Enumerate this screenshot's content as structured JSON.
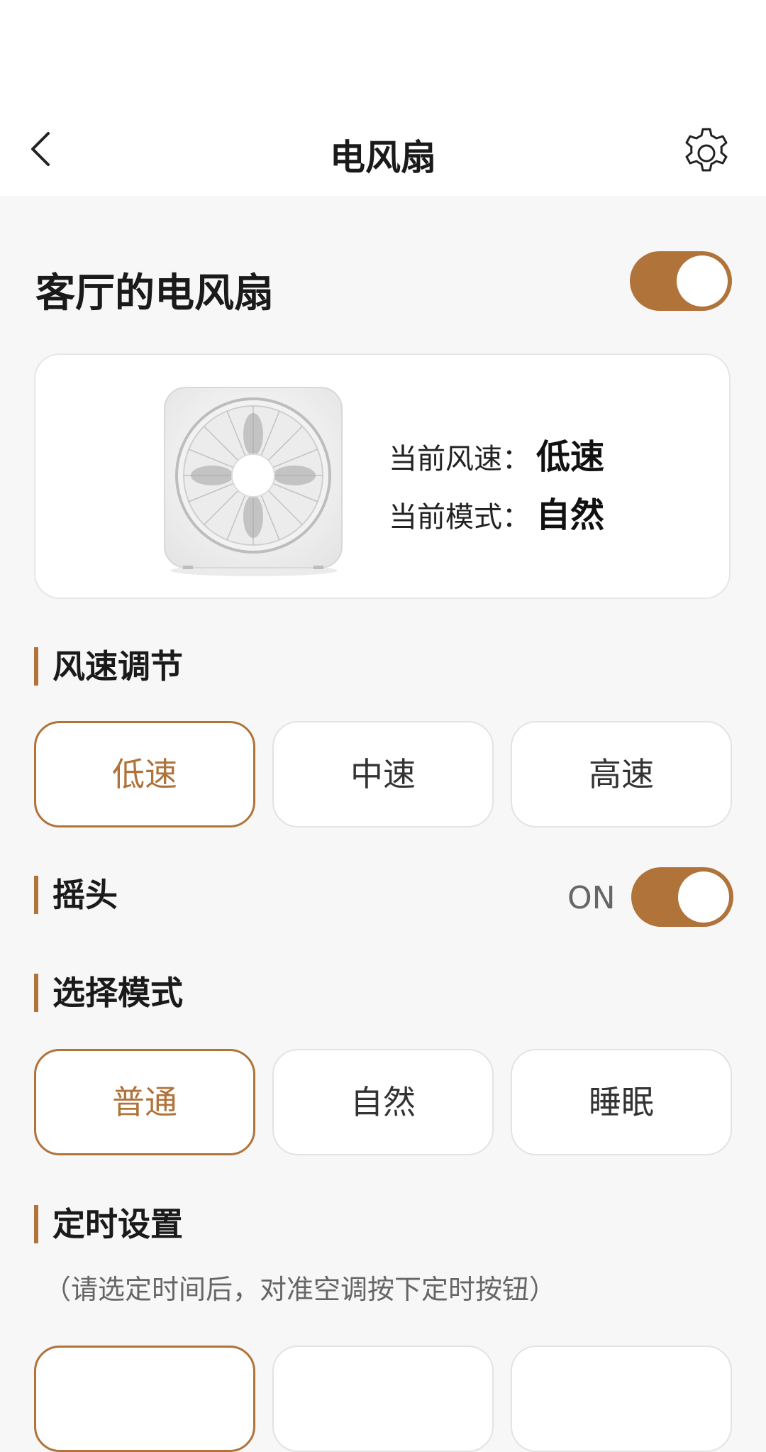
{
  "nav": {
    "title": "电风扇"
  },
  "device": {
    "name": "客厅的电风扇",
    "power_on": true
  },
  "status": {
    "speed_label": "当前风速：",
    "speed_value": "低速",
    "mode_label": "当前模式：",
    "mode_value": "自然"
  },
  "speed": {
    "title": "风速调节",
    "options": [
      "低速",
      "中速",
      "高速"
    ],
    "selected": "低速"
  },
  "swing": {
    "title": "摇头",
    "state": "ON"
  },
  "mode": {
    "title": "选择模式",
    "options": [
      "普通",
      "自然",
      "睡眠"
    ],
    "selected": "普通"
  },
  "timer": {
    "title": "定时设置",
    "hint": "（请选定时间后，对准空调按下定时按钮）"
  },
  "colors": {
    "accent": "#b0733a",
    "background": "#f7f7f7",
    "card": "#ffffff"
  },
  "icons": [
    "back-arrow-icon",
    "gear-icon"
  ]
}
